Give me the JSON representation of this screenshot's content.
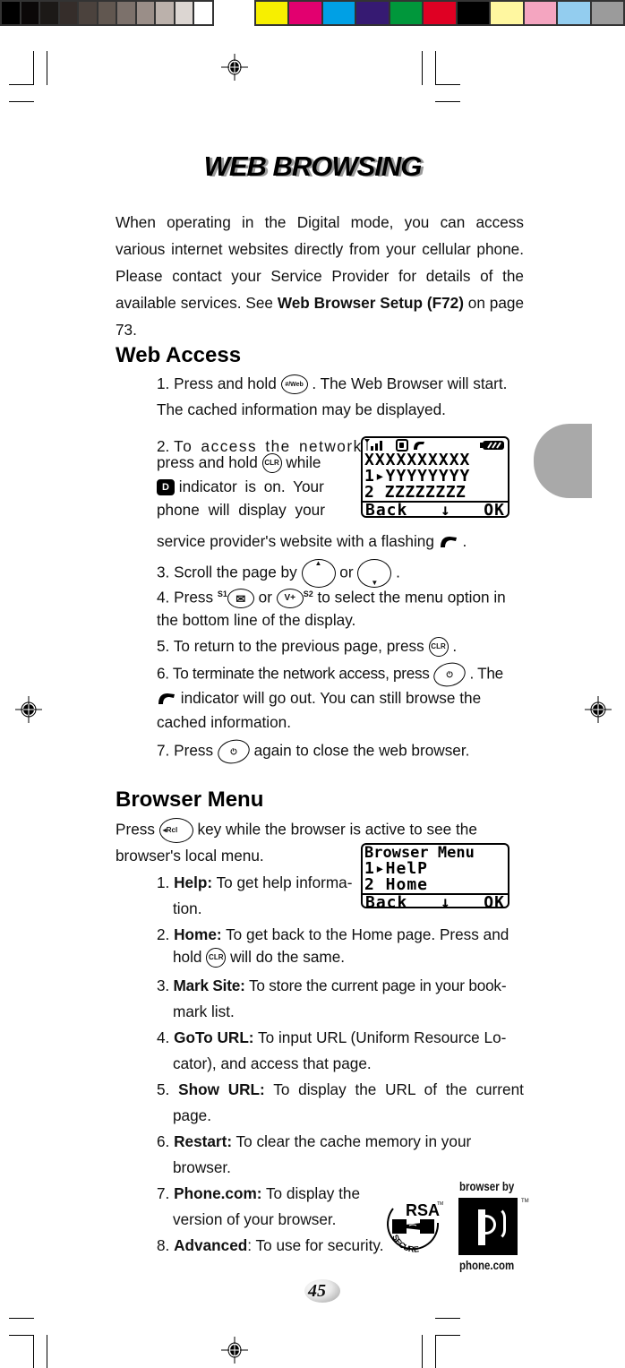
{
  "color_bars": {
    "grays": [
      "#000000",
      "#0b0808",
      "#1c1917",
      "#352d2a",
      "#4b423d",
      "#615750",
      "#7c716b",
      "#9a8e88",
      "#bbb1ab",
      "#dcd6d2",
      "#ffffff"
    ],
    "colors": [
      "#f7ef00",
      "#e2006f",
      "#00a0e5",
      "#361a72",
      "#00973b",
      "#df0023",
      "#000000",
      "#fff7a0",
      "#f4a5c0",
      "#93cdef",
      "#9b9b9b"
    ]
  },
  "title": "WEB BROWSING",
  "intro": {
    "text_before": "When operating in the Digital mode, you can access various internet websites directly from your cellular phone. Please contact your Service Provider for details of the available services. See ",
    "bold_ref": "Web Browser Setup (F72)",
    "text_after": " on page 73."
  },
  "web_access": {
    "heading": "Web Access",
    "steps": [
      {
        "num": "1.",
        "lines": [
          "Press and hold",
          ". The Web Browser will start.",
          "The cached information may be displayed."
        ],
        "key": "#/Web"
      },
      {
        "num": "2.",
        "lines": [
          "To access the network,",
          "press and hold",
          "while",
          "indicator is on. Your",
          "phone will display your",
          "service provider's website with a flashing",
          "."
        ],
        "key": "CLR",
        "indicator": "D"
      },
      {
        "num": "3.",
        "lines": [
          "Scroll the page by",
          "or",
          "."
        ]
      },
      {
        "num": "4.",
        "lines": [
          "Press",
          "or",
          "to select the menu option in",
          "the bottom line of the display."
        ],
        "key1_sup": "S1",
        "key2_label": "V+",
        "key2_sup": "S2"
      },
      {
        "num": "5.",
        "lines": [
          "To return to the previous page, press",
          "."
        ],
        "key": "CLR"
      },
      {
        "num": "6.",
        "lines": [
          "To terminate the network access, press",
          ". The",
          "indicator will go out. You can still browse the",
          "cached information."
        ]
      },
      {
        "num": "7.",
        "lines": [
          "Press",
          "again to close the web browser."
        ]
      }
    ],
    "lcd": {
      "status_icons": [
        "antenna-icon",
        "signal-bars-icon",
        "digital-d-icon",
        "handset-icon",
        "battery-icon"
      ],
      "rows": [
        "XXXXXXXXXX",
        "1▸YYYYYYYY",
        "2 ZZZZZZZZ"
      ],
      "softkeys": [
        "Back",
        "↓",
        "OK"
      ]
    }
  },
  "browser_menu": {
    "heading": "Browser Menu",
    "intro_before": "Press",
    "intro_key": "◂Rcl",
    "intro_after": "key while the browser is active to see the",
    "intro_line2": "browser's local menu.",
    "items": [
      {
        "num": "1.",
        "label": "Help:",
        "lines": [
          "To get help informa-",
          "tion."
        ]
      },
      {
        "num": "2.",
        "label": "Home:",
        "lines": [
          "To get back to the Home page.  Press and",
          "hold",
          "will do the same."
        ],
        "key": "CLR"
      },
      {
        "num": "3.",
        "label": "Mark Site:",
        "lines": [
          "To store the current page in your book-",
          "mark list."
        ]
      },
      {
        "num": "4.",
        "label": "GoTo URL:",
        "lines": [
          "To input URL (Uniform Resource Lo-",
          "cator), and access that page."
        ]
      },
      {
        "num": "5.",
        "label": "Show URL:",
        "lines": [
          "To display the URL of the current",
          "page."
        ]
      },
      {
        "num": "6.",
        "label": "Restart:",
        "lines": [
          "To clear the cache memory in your",
          "browser."
        ]
      },
      {
        "num": "7.",
        "label": "Phone.com:",
        "lines": [
          "To display the",
          "version of your browser."
        ]
      },
      {
        "num": "8.",
        "label": "Advanced",
        "lines": [
          ": To use for security."
        ]
      }
    ],
    "lcd": {
      "rows": [
        "Browser Menu",
        "1▸HelP",
        "2 Home"
      ],
      "softkeys": [
        "Back",
        "↓",
        "OK"
      ]
    }
  },
  "logos": {
    "rsa_text": "RSA",
    "rsa_tm": "TM",
    "rsa_secure": "SECURE",
    "phone_top": "browser by",
    "phone_bottom": "phone.com",
    "phone_tm": "TM"
  },
  "page_number": "45",
  "tab_color": "#a9a9a9"
}
